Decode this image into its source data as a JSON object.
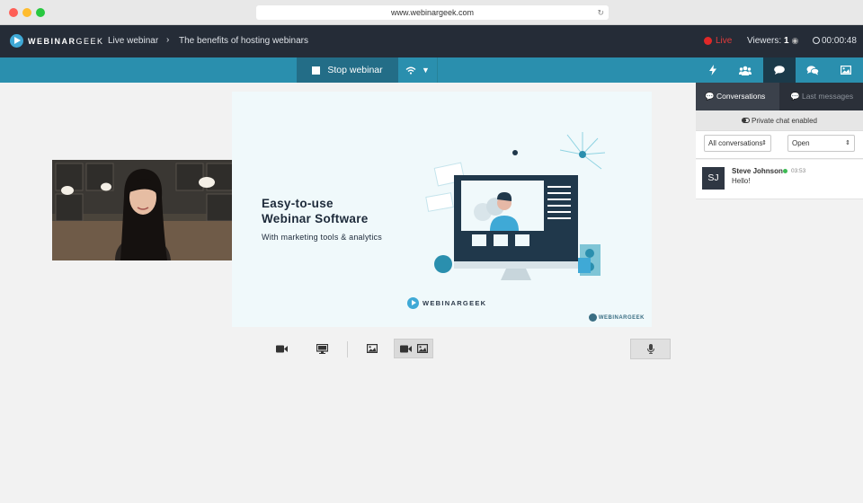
{
  "browser": {
    "url": "www.webinargeek.com"
  },
  "topbar": {
    "logo_bold": "WEBINAR",
    "logo_light": "GEEK",
    "breadcrumb_1": "Live webinar",
    "breadcrumb_sep": "›",
    "breadcrumb_2": "The benefits of hosting webinars",
    "live_label": "Live",
    "viewers_label": "Viewers:",
    "viewers_count": "1",
    "timer": "00:00:48"
  },
  "toolbar": {
    "stop_label": "Stop webinar",
    "icons": [
      "lightning-icon",
      "users-icon",
      "chat-icon",
      "conversations-icon",
      "image-icon"
    ]
  },
  "slide": {
    "title_line_1": "Easy-to-use",
    "title_line_2": "Webinar Software",
    "subtitle": "With marketing tools & analytics",
    "logo_text": "WEBINARGEEK",
    "watermark": "WEBINARGEEK"
  },
  "sidebar": {
    "tab_conversations": "Conversations",
    "tab_last_messages": "Last messages",
    "private_chat": "Private chat enabled",
    "filter_conversations": "All conversations",
    "filter_status": "Open",
    "messages": [
      {
        "initials": "SJ",
        "name": "Steve Johnson",
        "time": "03:53",
        "text": "Hello!"
      }
    ]
  },
  "colors": {
    "topbar": "#252c37",
    "toolbar": "#2a8fae",
    "stop_button": "#236d87",
    "live": "#e02828",
    "brand": "#3fa9d6"
  }
}
